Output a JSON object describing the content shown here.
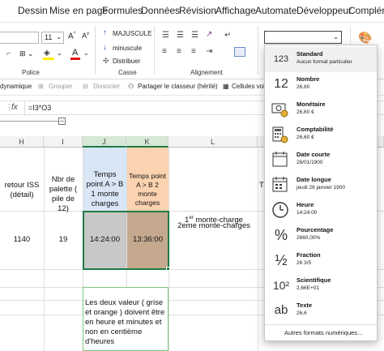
{
  "menu": [
    "Dessin",
    "Mise en page",
    "Formules",
    "Données",
    "Révision",
    "Affichage",
    "Automate",
    "Développeur",
    "Complém"
  ],
  "ribbon": {
    "font_size": "11",
    "majuscule_label": "MAJUSCULE",
    "minuscule_label": "minuscule",
    "distribuer_label": "Distribuer",
    "police_label": "Police",
    "casse_label": "Casse",
    "alignement_label": "Alignement"
  },
  "toolbar": {
    "dynamique_label": "dynamique",
    "grouper_label": "Grouper",
    "dissocier_label": "Dissocier",
    "partager_label": "Partager le classeur (hérité)",
    "cellules_label": "Cellules voi"
  },
  "formula": {
    "fx": "fx",
    "content": "=I3*O3"
  },
  "grid": {
    "columns": [
      "H",
      "I",
      "J",
      "K",
      "L"
    ],
    "cells": {
      "h3": "retour ISS (détail)",
      "i3": "Nbr de palette ( pile de 12)",
      "j3": "Temps point A > B 1 monte charges",
      "k3": "Temps point A > B 2 monte charges",
      "l_top": "1er monte-charge",
      "l_bottom": "2eme monte-charges",
      "h4": "1140",
      "i4": "19",
      "j4": "14:24:00",
      "k4": "13:36:00",
      "t_partial": "T",
      "note": "Les deux valeur ( grise et orange ) doivent être en heure et minutes et non en centième d'heures"
    },
    "colors": {
      "gray_cell": "#c8c8c8",
      "brown_cell": "#c4a98f",
      "blue_header": "#d9e6f5",
      "orange_header": "#fbd3b0",
      "selection": "#1e7b45"
    }
  },
  "dropdown": {
    "items": [
      {
        "title": "Standard",
        "sub": "Aucun format particulier",
        "icon": "number-format-icon"
      },
      {
        "title": "Nombre",
        "sub": "26,60",
        "icon": "number-icon"
      },
      {
        "title": "Monétaire",
        "sub": "26,60 €",
        "icon": "currency-icon"
      },
      {
        "title": "Comptabilité",
        "sub": " 26,60 €",
        "icon": "accounting-icon"
      },
      {
        "title": "Date courte",
        "sub": "26/01/1900",
        "icon": "calendar-short-icon"
      },
      {
        "title": "Date longue",
        "sub": "jeudi 26 janvier 1900",
        "icon": "calendar-long-icon"
      },
      {
        "title": "Heure",
        "sub": "14:24:00",
        "icon": "clock-icon"
      },
      {
        "title": "Pourcentage",
        "sub": "2660,00%",
        "icon": "percent-icon"
      },
      {
        "title": "Fraction",
        "sub": "26 3/5",
        "icon": "fraction-icon"
      },
      {
        "title": "Scientifique",
        "sub": "2,66E+01",
        "icon": "scientific-icon"
      },
      {
        "title": "Texte",
        "sub": "26,6",
        "icon": "text-icon"
      }
    ],
    "more": "Autres formats numériques...",
    "icon_labels": {
      "n12": "12",
      "pct": "%",
      "frac": "½",
      "sci": "10²",
      "ab": "ab",
      "std": "123"
    }
  }
}
